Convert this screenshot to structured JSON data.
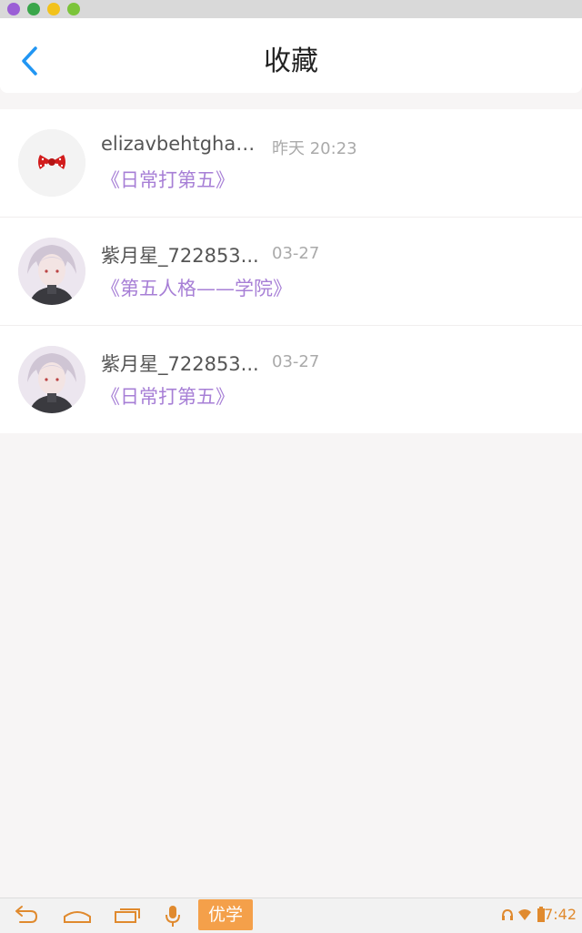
{
  "header": {
    "title": "收藏"
  },
  "favorites": [
    {
      "name": "elizavbehtghand..",
      "time": "昨天 20:23",
      "post": "《日常打第五》"
    },
    {
      "name": "紫月星_722853...",
      "time": "03-27",
      "post": "《第五人格——学院》"
    },
    {
      "name": "紫月星_722853...",
      "time": "03-27",
      "post": "《日常打第五》"
    }
  ],
  "navbar": {
    "app_label": "优学",
    "clock": "7:42"
  },
  "colors": {
    "accent": "#2196f3",
    "post_link": "#a77fd6",
    "nav_orange": "#f4a04a"
  }
}
